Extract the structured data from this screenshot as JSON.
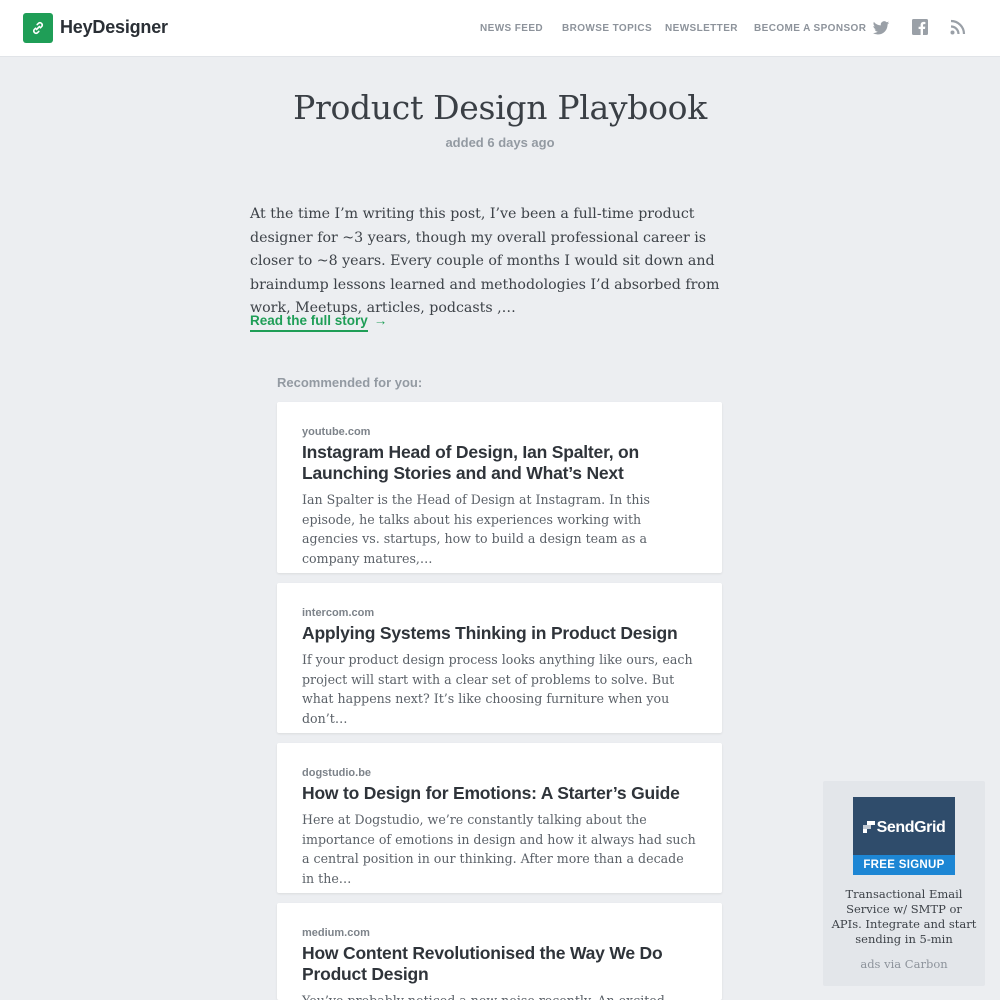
{
  "header": {
    "brand": "HeyDesigner",
    "nav": [
      "NEWS FEED",
      "BROWSE TOPICS",
      "NEWSLETTER",
      "BECOME A SPONSOR"
    ],
    "social_icons": [
      "twitter-icon",
      "facebook-icon",
      "rss-icon"
    ],
    "accent_color": "#1f9e57"
  },
  "article": {
    "title": "Product Design Playbook",
    "added": "added 6 days ago",
    "excerpt": "At the time I’m writing this post, I’ve been a full-time product designer for ~3 years, though my overall professional career is closer to ~8 years. Every couple of months I would sit down and braindump lessons learned and methodologies I’d absorbed from work, Meetups, articles, podcasts ,…",
    "read_more": "Read the full story",
    "arrow": "→"
  },
  "recommended": {
    "label": "Recommended for you:",
    "items": [
      {
        "source": "youtube.com",
        "title": "Instagram Head of Design, Ian Spalter, on Launching Stories and and What’s Next",
        "desc": "Ian Spalter is the Head of Design at Instagram. In this episode, he talks about his experiences working with agencies vs. startups, how to build a design team as a company matures,…"
      },
      {
        "source": "intercom.com",
        "title": "Applying Systems Thinking in Product Design",
        "desc": "If your product design process looks anything like ours, each project will start with a clear set of problems to solve. But what happens next? It’s like choosing furniture when you don’t…"
      },
      {
        "source": "dogstudio.be",
        "title": "How to Design for Emotions: A Starter’s Guide",
        "desc": "Here at Dogstudio, we’re constantly talking about the importance of emotions in design and how it always had such a central position in our thinking. After more than a decade in the…"
      },
      {
        "source": "medium.com",
        "title": "How Content Revolutionised the Way We Do Product Design",
        "desc": "You’ve probably noticed a new noise recently. An excited crackling in"
      }
    ]
  },
  "ad": {
    "brand": "SendGrid",
    "cta": "FREE SIGNUP",
    "text": "Transactional Email Service w/ SMTP or APIs. Integrate and start sending in 5-min",
    "via": "ads via Carbon"
  }
}
